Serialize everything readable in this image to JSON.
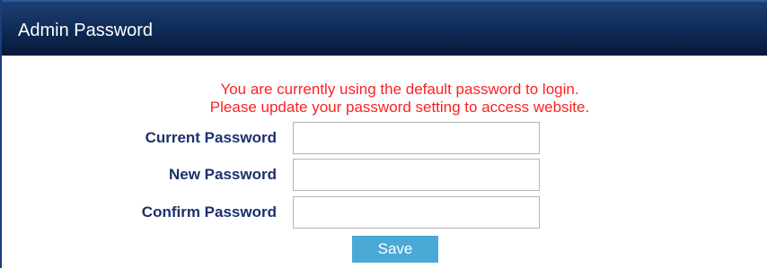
{
  "panel": {
    "title": "Admin Password"
  },
  "warning": {
    "line1": "You are currently using the default password to login.",
    "line2": "Please update your password setting to access website."
  },
  "form": {
    "current_password": {
      "label": "Current Password",
      "value": "",
      "placeholder": ""
    },
    "new_password": {
      "label": "New Password",
      "value": "",
      "placeholder": ""
    },
    "confirm_password": {
      "label": "Confirm Password",
      "value": "",
      "placeholder": ""
    },
    "save_label": "Save"
  },
  "colors": {
    "header_bg": "#0f2a55",
    "warning_text": "#ff2020",
    "label_text": "#1c2f6e",
    "save_button_bg": "#4aa9d6"
  }
}
